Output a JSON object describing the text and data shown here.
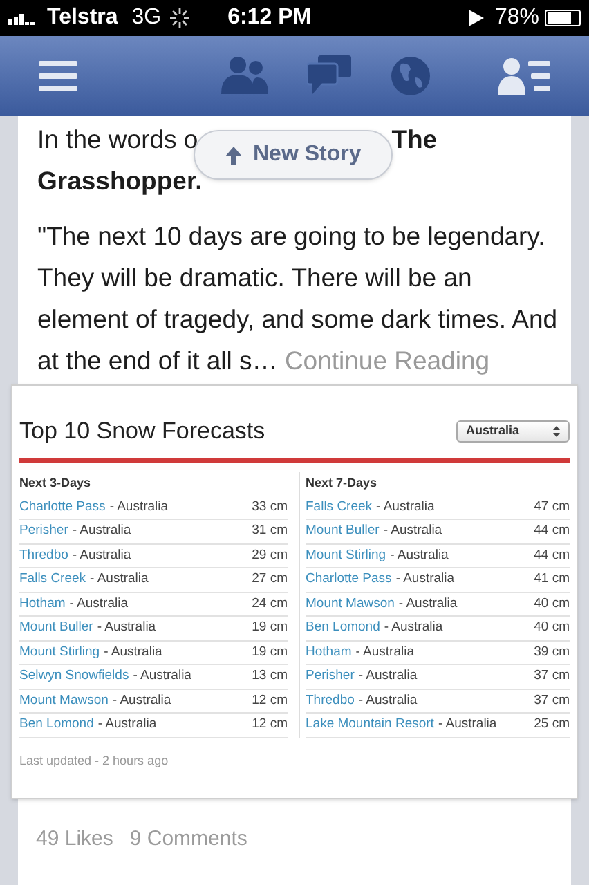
{
  "status_bar": {
    "carrier": "Telstra",
    "network": "3G",
    "time": "6:12 PM",
    "battery": "78%"
  },
  "post": {
    "intro_visible": "In the words o",
    "intro_bold_1": "The",
    "intro_bold_2": "Grasshopper.",
    "new_story": "New Story",
    "body": "\"The next 10 days are going to be legendary. They will be dramatic. There will be an element of tragedy, and some dark times. And at the end of it all s…",
    "continue": "Continue Reading",
    "likes": "49 Likes",
    "comments": "9 Comments"
  },
  "widget": {
    "title": "Top 10 Snow Forecasts",
    "region_select": "Australia",
    "updated": "Last updated - 2 hours ago",
    "columns": [
      {
        "heading": "Next 3-Days",
        "rows": [
          {
            "name": "Charlotte Pass",
            "country": "- Australia",
            "depth": "33 cm"
          },
          {
            "name": "Perisher",
            "country": "- Australia",
            "depth": "31 cm"
          },
          {
            "name": "Thredbo",
            "country": "- Australia",
            "depth": "29 cm"
          },
          {
            "name": "Falls Creek",
            "country": "- Australia",
            "depth": "27 cm"
          },
          {
            "name": "Hotham",
            "country": "- Australia",
            "depth": "24 cm"
          },
          {
            "name": "Mount Buller",
            "country": "- Australia",
            "depth": "19 cm"
          },
          {
            "name": "Mount Stirling",
            "country": "- Australia",
            "depth": "19 cm"
          },
          {
            "name": "Selwyn Snowfields",
            "country": "- Australia",
            "depth": "13 cm"
          },
          {
            "name": "Mount Mawson",
            "country": "- Australia",
            "depth": "12 cm"
          },
          {
            "name": "Ben Lomond",
            "country": "- Australia",
            "depth": "12 cm"
          }
        ]
      },
      {
        "heading": "Next 7-Days",
        "rows": [
          {
            "name": "Falls Creek",
            "country": "- Australia",
            "depth": "47 cm"
          },
          {
            "name": "Mount Buller",
            "country": "- Australia",
            "depth": "44 cm"
          },
          {
            "name": "Mount Stirling",
            "country": "- Australia",
            "depth": "44 cm"
          },
          {
            "name": "Charlotte Pass",
            "country": "- Australia",
            "depth": "41 cm"
          },
          {
            "name": "Mount Mawson",
            "country": "- Australia",
            "depth": "40 cm"
          },
          {
            "name": "Ben Lomond",
            "country": "- Australia",
            "depth": "40 cm"
          },
          {
            "name": "Hotham",
            "country": "- Australia",
            "depth": "39 cm"
          },
          {
            "name": "Perisher",
            "country": "- Australia",
            "depth": "37 cm"
          },
          {
            "name": "Thredbo",
            "country": "- Australia",
            "depth": "37 cm"
          },
          {
            "name": "Lake Mountain Resort",
            "country": "- Australia",
            "depth": "25 cm"
          }
        ]
      }
    ]
  }
}
